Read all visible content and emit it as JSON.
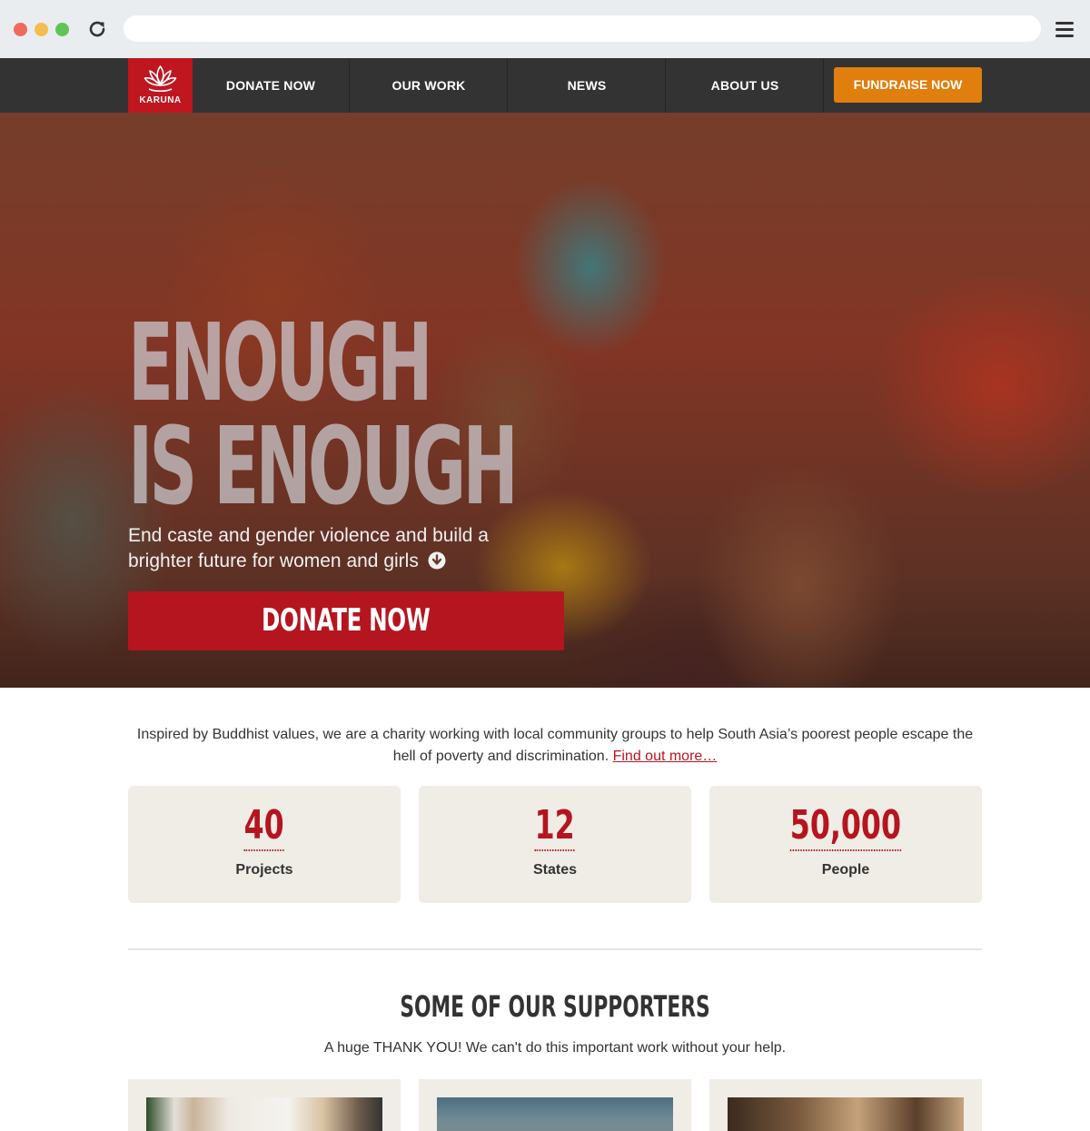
{
  "nav": {
    "logo_text": "KARUNA",
    "items": [
      {
        "label": "DONATE NOW"
      },
      {
        "label": "OUR WORK"
      },
      {
        "label": "NEWS"
      },
      {
        "label": "ABOUT US"
      }
    ],
    "cta_label": "FUNDRAISE NOW"
  },
  "hero": {
    "title_line1": "ENOUGH",
    "title_line2": "IS ENOUGH",
    "subtitle": "End caste and gender violence and build a brighter future for women and girls",
    "donate_label": "DONATE NOW"
  },
  "intro": {
    "text": "Inspired by Buddhist values, we are a charity working with local community groups to help South Asia’s poorest people escape the hell of poverty and discrimination.",
    "link_text": "Find out more…"
  },
  "stats": [
    {
      "number": "40",
      "label": "Projects"
    },
    {
      "number": "12",
      "label": "States"
    },
    {
      "number": "50,000",
      "label": "People"
    }
  ],
  "supporters": {
    "title": "SOME OF OUR SUPPORTERS",
    "subtitle": "A huge THANK YOU! We can't do this important work without your help."
  },
  "colors": {
    "brand_red": "#b5151f",
    "cta_orange": "#e07e0e",
    "nav_bg": "#333333",
    "card_bg": "#efede6"
  }
}
